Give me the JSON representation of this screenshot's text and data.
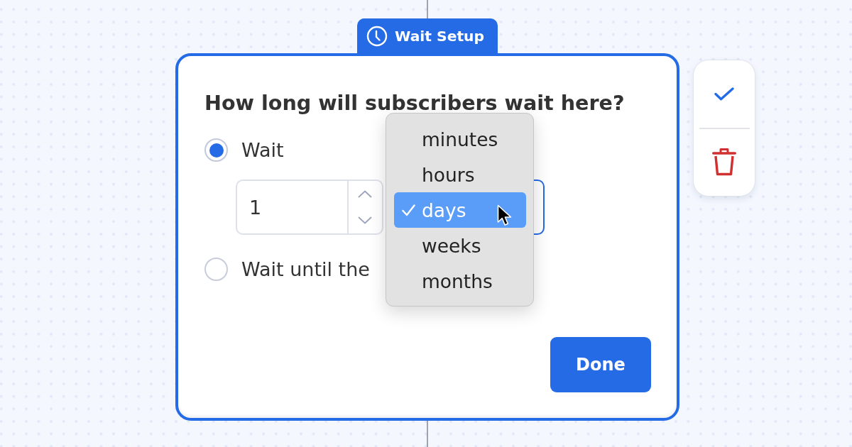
{
  "node_tab": {
    "title": "Wait Setup"
  },
  "card": {
    "prompt": "How long will subscribers wait here?",
    "options": [
      {
        "kind": "duration",
        "label": "Wait",
        "selected": true,
        "amount": "1",
        "unit_select": {
          "expanded": true,
          "items": [
            {
              "label": "minutes",
              "selected": false
            },
            {
              "label": "hours",
              "selected": false
            },
            {
              "label": "days",
              "selected": true
            },
            {
              "label": "weeks",
              "selected": false
            },
            {
              "label": "months",
              "selected": false
            }
          ]
        }
      },
      {
        "kind": "until",
        "label": "Wait until the",
        "selected": false
      }
    ],
    "done_button": "Done"
  }
}
